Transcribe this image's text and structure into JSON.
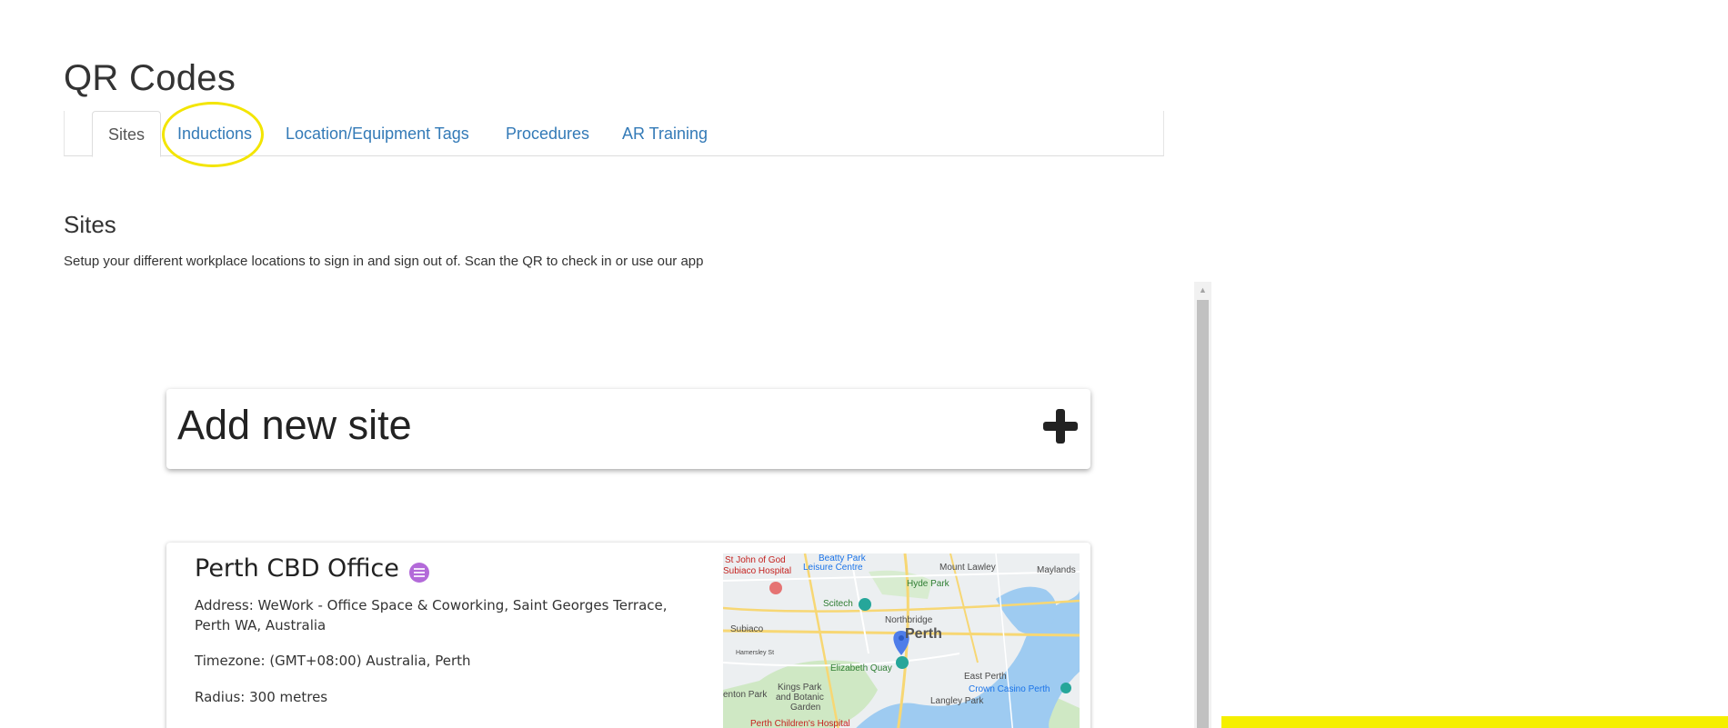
{
  "page": {
    "title": "QR Codes"
  },
  "tabs": [
    {
      "label": "Sites"
    },
    {
      "label": "Inductions"
    },
    {
      "label": "Location/Equipment Tags"
    },
    {
      "label": "Procedures"
    },
    {
      "label": "AR Training"
    }
  ],
  "active_tab": "Sites",
  "section": {
    "title": "Sites",
    "description": "Setup your different workplace locations to sign in and sign out of. Scan the QR to check in or use our app"
  },
  "add_site": {
    "label": "Add new site"
  },
  "site": {
    "name": "Perth CBD Office",
    "address": "Address: WeWork - Office Space & Coworking, Saint Georges Terrace, Perth WA, Australia",
    "timezone": "Timezone: (GMT+08:00) Australia, Perth",
    "radius": "Radius: 300 metres"
  },
  "map": {
    "labels": {
      "st_john": "St John of God",
      "subiaco_hospital": "Subiaco Hospital",
      "beatty_park": "Beatty Park",
      "leisure_centre": "Leisure Centre",
      "mount_lawley": "Mount Lawley",
      "maylands": "Maylands",
      "hyde_park": "Hyde Park",
      "scitech": "Scitech",
      "northbridge": "Northbridge",
      "perth": "Perth",
      "subiaco": "Subiaco",
      "elizabeth_quay": "Elizabeth Quay",
      "east_perth": "East Perth",
      "kings_park": "Kings Park",
      "and_botanic": "and Botanic",
      "garden": "Garden",
      "crown_casino": "Crown Casino Perth",
      "langley_park": "Langley Park",
      "enton_park": "enton Park",
      "childrens_hospital": "Perth Children's Hospital",
      "haldane": "Hamersley St"
    }
  },
  "colors": {
    "link": "#337ab7",
    "highlight": "#f3e500",
    "badge": "#b36ad9",
    "yellow_bar": "#f5ef00"
  }
}
